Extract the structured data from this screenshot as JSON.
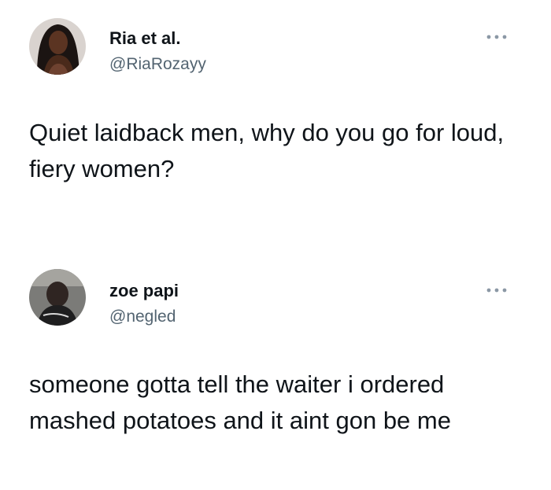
{
  "tweets": [
    {
      "display_name": "Ria et al.",
      "handle": "@RiaRozayy",
      "text": "Quiet laidback men, why do you go for loud, fiery women?",
      "avatar_icon": "user-avatar-photo",
      "more_icon": "more-options-icon"
    },
    {
      "display_name": "zoe papi",
      "handle": "@negled",
      "text": "someone gotta tell the waiter i ordered mashed potatoes and it aint gon be me",
      "avatar_icon": "user-avatar-photo",
      "more_icon": "more-options-icon"
    }
  ],
  "colors": {
    "text_primary": "#0f1419",
    "text_secondary": "#536471",
    "icon_gray": "#8b98a5",
    "background": "#ffffff"
  }
}
